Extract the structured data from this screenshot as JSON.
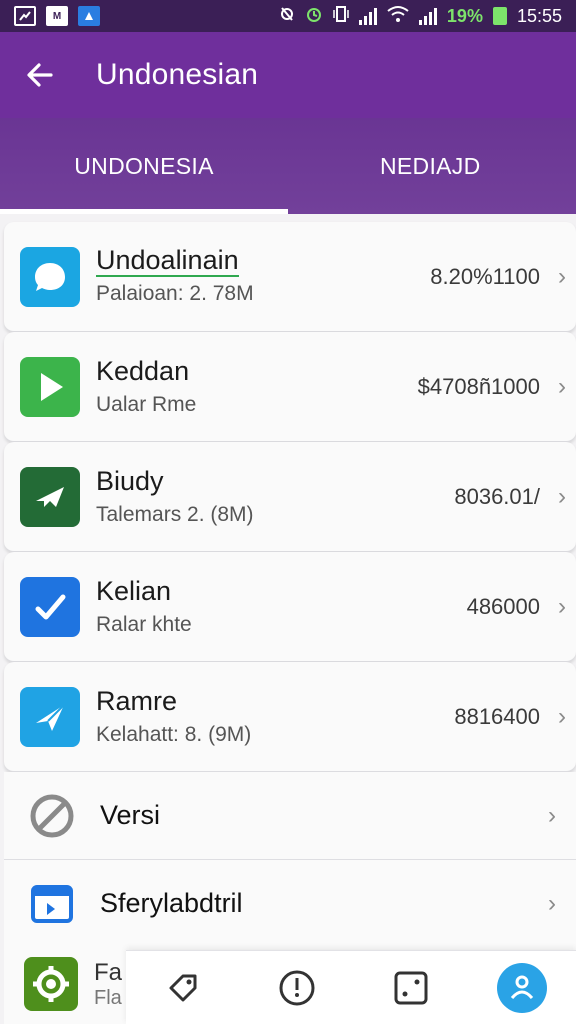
{
  "status_bar": {
    "battery": "19%",
    "time": "15:55",
    "app_badges": [
      "",
      "M",
      ""
    ]
  },
  "header": {
    "title": "Undonesian"
  },
  "tabs": [
    {
      "label": "UNDONESIA",
      "active": true
    },
    {
      "label": "NEDIAJD",
      "active": false
    }
  ],
  "apps": [
    {
      "title": "Undoalinain",
      "subtitle": "Palaioan: 2. 78M",
      "value": "8.20%1100",
      "icon": "chat-bubble-icon",
      "color": "#1ba6e2"
    },
    {
      "title": "Keddan",
      "subtitle": "Ualar Rme",
      "value": "$4708ñ1000",
      "icon": "play-icon",
      "color": "#3cb44b"
    },
    {
      "title": "Biudy",
      "subtitle": "Talemars 2. (8M)",
      "value": "8036.01/",
      "icon": "plane-icon",
      "color": "#236b36"
    },
    {
      "title": "Kelian",
      "subtitle": "Ralar khte",
      "value": "486000",
      "icon": "check-icon",
      "color": "#1f74e0"
    },
    {
      "title": "Ramre",
      "subtitle": "Kelahatt: 8. (9M)",
      "value": "8816400",
      "icon": "send-icon",
      "color": "#20a3e4"
    }
  ],
  "settings_rows": [
    {
      "label": "Versi",
      "icon": "no-entry-icon"
    },
    {
      "label": "Sferylabdtril",
      "icon": "calendar-icon"
    }
  ],
  "partial_row": {
    "title": "Fa",
    "subtitle": "Fla",
    "icon": "gear-icon"
  },
  "bottom_nav": [
    {
      "icon": "tag-icon",
      "active": false
    },
    {
      "icon": "compass-icon",
      "active": false
    },
    {
      "icon": "dice-icon",
      "active": false
    },
    {
      "icon": "person-icon",
      "active": true
    }
  ],
  "colors": {
    "status_bar": "#3b1f56",
    "app_bar": "#6f2f9c",
    "tabs": "#6e3a97",
    "accent": "#2aa3e6"
  }
}
